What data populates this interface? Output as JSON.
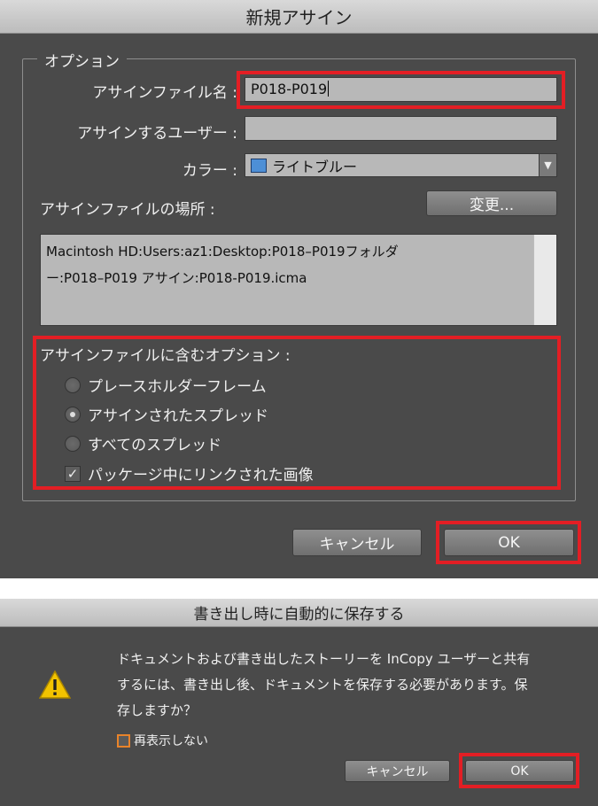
{
  "assign_dialog": {
    "title": "新規アサイン",
    "group_label": "オプション",
    "filename_label": "アサインファイル名 :",
    "filename_value": "P018-P019",
    "user_label": "アサインするユーザー :",
    "user_value": "",
    "color_label": "カラー :",
    "color_value": "ライトブルー",
    "color_swatch": "#4d8fd6",
    "location_label": "アサインファイルの場所 :",
    "change_button": "変更...",
    "path_line1": "Macintosh HD:Users:az1:Desktop:P018–P019フォルダ",
    "path_line2": "ー:P018–P019 アサイン:P018-P019.icma",
    "include_label": "アサインファイルに含むオプション :",
    "options": [
      {
        "label": "プレースホルダーフレーム",
        "selected": false
      },
      {
        "label": "アサインされたスプレッド",
        "selected": true
      },
      {
        "label": "すべてのスプレッド",
        "selected": false
      }
    ],
    "package_images_label": "パッケージ中にリンクされた画像",
    "package_images_checked": true,
    "cancel_button": "キャンセル",
    "ok_button": "OK",
    "highlight_color": "#e31e24"
  },
  "save_dialog": {
    "title": "書き出し時に自動的に保存する",
    "message_line1": "ドキュメントおよび書き出したストーリーを InCopy ユーザーと共有",
    "message_line2": "するには、書き出し後、ドキュメントを保存する必要があります。保",
    "message_line3": "存しますか？",
    "dont_show_label": "再表示しない",
    "cancel_button": "キャンセル",
    "ok_button": "OK",
    "icon": "warning-icon"
  }
}
